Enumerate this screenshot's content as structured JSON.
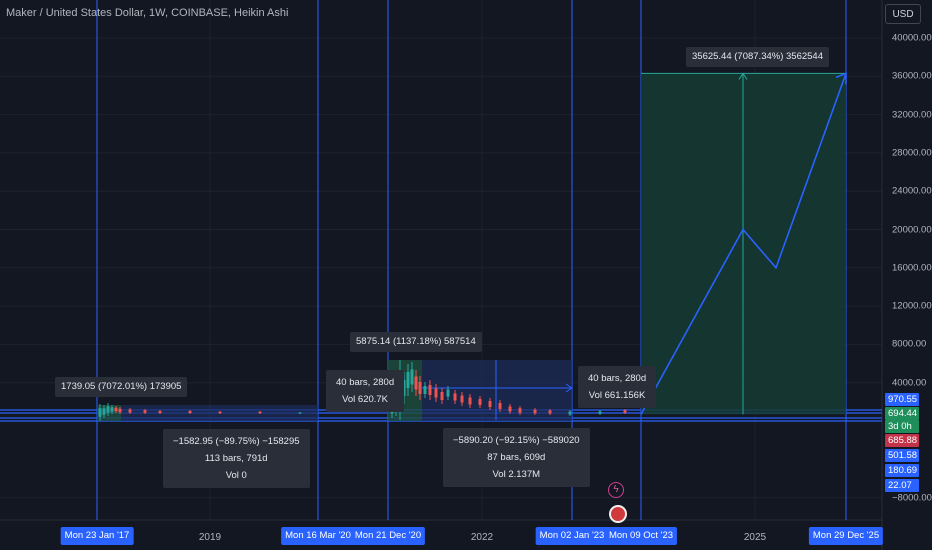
{
  "header": {
    "symbol_title": "Maker / United States Dollar, 1W, COINBASE, Heikin Ashi",
    "currency": "USD"
  },
  "chart_data": {
    "type": "candlestick-with-projection",
    "title": "Maker / United States Dollar, 1W, COINBASE, Heikin Ashi",
    "ylim": [
      -8000,
      40000
    ],
    "y_ticks": [
      40000,
      36000,
      32000,
      28000,
      24000,
      20000,
      16000,
      12000,
      8000,
      4000,
      -8000
    ],
    "y_tick_labels": [
      "40000.00",
      "36000.00",
      "32000.00",
      "28000.00",
      "24000.00",
      "20000.00",
      "16000.00",
      "12000.00",
      "8000.00",
      "4000.00",
      "−8000.00"
    ],
    "x_year_ticks": [
      "2019",
      "2022",
      "2025"
    ],
    "date_markers": [
      "Mon 23 Jan '17",
      "Mon 16 Mar '20",
      "Mon 21 Dec '20",
      "Mon 02 Jan '23",
      "Mon 09 Oct '23",
      "Mon 29 Dec '25"
    ],
    "price_scale_labels": [
      {
        "text": "970.55",
        "color": "#2962ff"
      },
      {
        "text": "694.44",
        "color": "#1e8f5a"
      },
      {
        "text": "3d 0h",
        "color": "#1e8f5a"
      },
      {
        "text": "685.88",
        "color": "#c2334a"
      },
      {
        "text": "501.58",
        "color": "#2962ff"
      },
      {
        "text": "180.69",
        "color": "#2962ff"
      },
      {
        "text": "22.07",
        "color": "#2962ff"
      }
    ],
    "measurements": [
      {
        "lines": [
          "1739.05 (7072.01%) 173905"
        ]
      },
      {
        "lines": [
          "−1582.95 (−89.75%) −158295",
          "113 bars, 791d",
          "Vol 0"
        ]
      },
      {
        "lines": [
          "5875.14 (1137.18%) 587514"
        ]
      },
      {
        "lines": [
          "40 bars, 280d",
          "Vol 620.7K"
        ]
      },
      {
        "lines": [
          "−5890.20 (−92.15%) −589020",
          "87 bars, 609d",
          "Vol 2.137M"
        ]
      },
      {
        "lines": [
          "40 bars, 280d",
          "Vol 661.156K"
        ]
      },
      {
        "lines": [
          "35625.44 (7087.34%) 3562544"
        ]
      }
    ],
    "projection_path": [
      {
        "date": "Mon 09 Oct '23",
        "price": 690
      },
      {
        "date": "2025 early",
        "price": 20000
      },
      {
        "date": "2025 mid",
        "price": 16000
      },
      {
        "date": "Mon 29 Dec '25",
        "price": 36300
      }
    ],
    "target_box": {
      "from_price": 690,
      "to_price": 36300
    },
    "colors": {
      "background": "#131722",
      "line": "#2962ff",
      "up": "#26a69a",
      "down": "#ef5350",
      "target_fill": "#153b33"
    }
  }
}
